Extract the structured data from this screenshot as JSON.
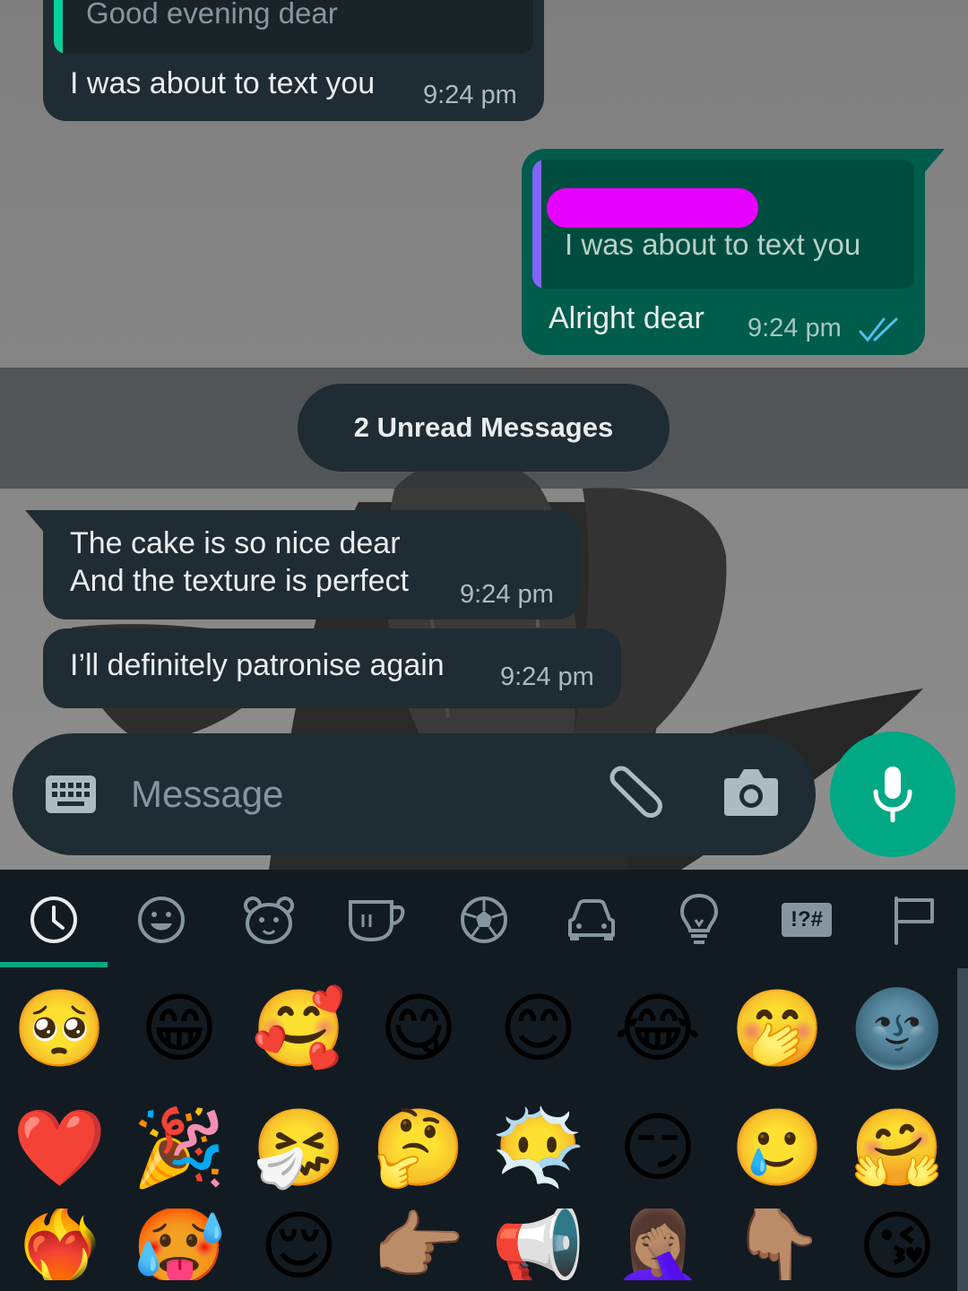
{
  "conversation": {
    "msg1": {
      "quote_text": "Good evening dear",
      "text": "I was about to text you",
      "time": "9:24 pm"
    },
    "msg2": {
      "quote_text": "I was about to text you",
      "text": "Alright dear",
      "time": "9:24 pm"
    },
    "unread_label": "2 Unread Messages",
    "msg3": {
      "line1": "The cake is so nice dear",
      "line2": "And the texture is perfect",
      "time": "9:24 pm"
    },
    "msg4": {
      "text": "I’ll definitely patronise again",
      "time": "9:24 pm"
    }
  },
  "composer": {
    "placeholder": "Message"
  },
  "emoji_categories": [
    {
      "icon": "clock-icon"
    },
    {
      "icon": "smiley-icon"
    },
    {
      "icon": "bear-icon"
    },
    {
      "icon": "cup-icon"
    },
    {
      "icon": "ball-icon"
    },
    {
      "icon": "car-icon"
    },
    {
      "icon": "bulb-icon"
    },
    {
      "icon": "symbols-icon",
      "label": "!?#"
    },
    {
      "icon": "flag-icon"
    }
  ],
  "emojis": [
    "🥺",
    "😁",
    "🥰",
    "😋",
    "😊",
    "😂",
    "🤭",
    "🌚",
    "❤️",
    "🎉",
    "🤧",
    "🤔",
    "😶‍🌫️",
    "😏",
    "🥲",
    "🤗",
    "❤️‍🔥",
    "🥵",
    "😌",
    "👉🏽",
    "📢",
    "🤦🏽‍♀️",
    "👇🏽",
    "😘"
  ],
  "colors": {
    "accent": "#00a884",
    "incoming": "#202c33",
    "outgoing": "#005c4b",
    "read_ticks": "#53bdeb"
  }
}
